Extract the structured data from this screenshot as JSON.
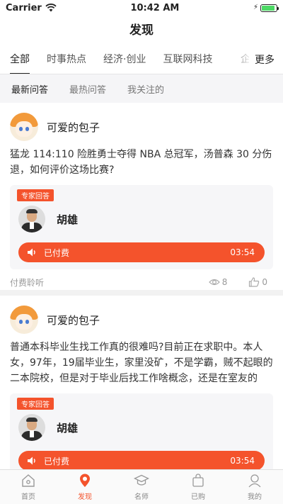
{
  "status_bar": {
    "carrier": "Carrier",
    "time": "10:42 AM"
  },
  "nav": {
    "title": "发现"
  },
  "category_tabs": {
    "items": [
      {
        "label": "全部",
        "active": true
      },
      {
        "label": "时事热点",
        "active": false
      },
      {
        "label": "经济·创业",
        "active": false
      },
      {
        "label": "互联网科技",
        "active": false
      }
    ],
    "cut_glyph": "企",
    "more_label": "更多"
  },
  "sub_tabs": [
    {
      "label": "最新问答",
      "active": true
    },
    {
      "label": "最热问答",
      "active": false
    },
    {
      "label": "我关注的",
      "active": false
    }
  ],
  "feed": [
    {
      "author": "可爱的包子",
      "question": "猛龙 114:110 险胜勇士夺得 NBA 总冠军，汤普森 30 分伤退，如何评价这场比赛?",
      "expert_tag": "专家回答",
      "expert_name": "胡雄",
      "pay_label": "已付费",
      "duration": "03:54",
      "meta_label": "付费聆听",
      "views": "8",
      "likes": "0"
    },
    {
      "author": "可爱的包子",
      "question": "普通本科毕业生找工作真的很难吗?目前正在求职中。本人女，97年，19届毕业生，家里没矿，不是学霸，贼不起眼的二本院校，但是对于毕业后找工作啥概念，还是在室友的",
      "expert_tag": "专家回答",
      "expert_name": "胡雄",
      "pay_label": "已付费",
      "duration": "03:54"
    }
  ],
  "tab_bar": [
    {
      "label": "首页",
      "icon": "home-icon",
      "active": false
    },
    {
      "label": "发现",
      "icon": "discover-icon",
      "active": true
    },
    {
      "label": "名师",
      "icon": "graduation-cap-icon",
      "active": false
    },
    {
      "label": "已购",
      "icon": "shopping-bag-icon",
      "active": false
    },
    {
      "label": "我的",
      "icon": "profile-icon",
      "active": false
    }
  ],
  "colors": {
    "accent": "#f4532c",
    "tab_active": "#f4532c",
    "battery": "#4cd964"
  }
}
